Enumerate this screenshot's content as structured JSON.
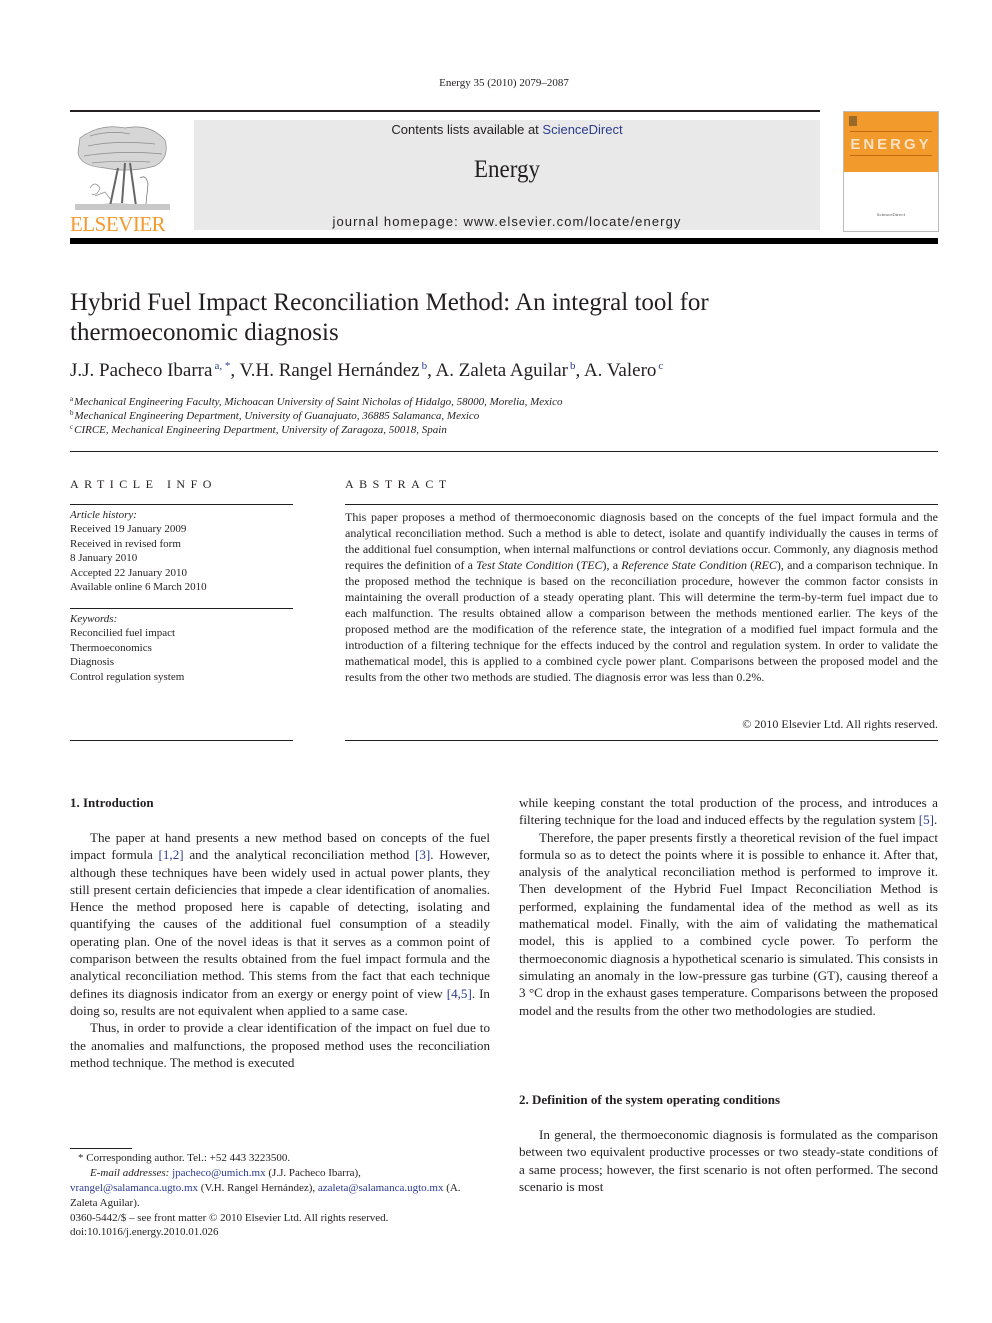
{
  "header": {
    "journal_ref": "Energy 35 (2010) 2079–2087",
    "contents_prefix": "Contents lists available at ",
    "contents_link": "ScienceDirect",
    "journal_name": "Energy",
    "homepage": "journal homepage: www.elsevier.com/locate/energy",
    "publisher_logo_text": "ELSEVIER",
    "cover_title": "ENERGY",
    "colors": {
      "publisher_orange": "#f39a2c",
      "link_blue": "#2b3b8f"
    }
  },
  "article": {
    "title": "Hybrid Fuel Impact Reconciliation Method: An integral tool for thermoeconomic diagnosis",
    "authors": [
      {
        "name": "J.J. Pacheco Ibarra",
        "sup": "a, *"
      },
      {
        "name": "V.H. Rangel Hernández",
        "sup": "b"
      },
      {
        "name": "A. Zaleta Aguilar",
        "sup": "b"
      },
      {
        "name": "A. Valero",
        "sup": "c"
      }
    ],
    "affiliations": [
      {
        "key": "a",
        "text": "Mechanical Engineering Faculty, Michoacan University of Saint Nicholas of Hidalgo, 58000, Morelia, Mexico"
      },
      {
        "key": "b",
        "text": "Mechanical Engineering Department, University of Guanajuato, 36885 Salamanca, Mexico"
      },
      {
        "key": "c",
        "text": "CIRCE, Mechanical Engineering Department, University of Zaragoza, 50018, Spain"
      }
    ]
  },
  "article_info": {
    "heading": "ARTICLE INFO",
    "history_label": "Article history:",
    "history": [
      "Received 19 January 2009",
      "Received in revised form",
      "8 January 2010",
      "Accepted 22 January 2010",
      "Available online 6 March 2010"
    ],
    "keywords_label": "Keywords:",
    "keywords": [
      "Reconcilied fuel impact",
      "Thermoeconomics",
      "Diagnosis",
      "Control regulation system"
    ]
  },
  "abstract": {
    "heading": "ABSTRACT",
    "part1": "This paper proposes a method of thermoeconomic diagnosis based on the concepts of the fuel impact formula and the analytical reconciliation method. Such a method is able to detect, isolate and quantify individually the causes in terms of the additional fuel consumption, when internal malfunctions or control deviations occur. Commonly, any diagnosis method requires the definition of a ",
    "tsc": "Test State Condition",
    "tec": "TEC",
    "mid": "), a ",
    "rsc": "Reference State Condition",
    "rec": "REC",
    "part2": "), and a comparison technique. In the proposed method the technique is based on the reconciliation procedure, however the common factor consists in maintaining the overall production of a steady operating plant. This will determine the term-by-term fuel impact due to each malfunction. The results obtained allow a comparison between the methods mentioned earlier. The keys of the proposed method are the modification of the reference state, the integration of a modified fuel impact formula and the introduction of a filtering technique for the effects induced by the control and regulation system. In order to validate the mathematical model, this is applied to a combined cycle power plant. Comparisons between the proposed model and the results from the other two methods are studied. The diagnosis error was less than 0.2%.",
    "copyright": "© 2010 Elsevier Ltd. All rights reserved."
  },
  "body": {
    "sec1_title": "1.  Introduction",
    "sec1_p1_a": "The paper at hand presents a new method based on concepts of the fuel impact formula ",
    "ref_12": "[1,2]",
    "sec1_p1_b": " and the analytical reconciliation method ",
    "ref_3": "[3]",
    "sec1_p1_c": ". However, although these techniques have been widely used in actual power plants, they still present certain deficiencies that impede a clear identification of anomalies. Hence the method proposed here is capable of detecting, isolating and quantifying the causes of the additional fuel consumption of a steadily operating plan. One of the novel ideas is that it serves as a common point of comparison between the results obtained from the fuel impact formula and the analytical reconciliation method. This stems from the fact that each technique defines its diagnosis indicator from an exergy or energy point of view ",
    "ref_45": "[4,5]",
    "sec1_p1_d": ". In doing so, results are not equivalent when applied to a same case.",
    "sec1_p2": "Thus, in order to provide a clear identification of the impact on fuel due to the anomalies and malfunctions, the proposed method uses the reconciliation method technique. The method is executed",
    "col2_p1_a": "while keeping constant the total production of the process, and introduces a filtering technique for the load and induced effects by the regulation system ",
    "ref_5": "[5]",
    "col2_p1_b": ".",
    "col2_p2": "Therefore, the paper presents firstly a theoretical revision of the fuel impact formula so as to detect the points where it is possible to enhance it. After that, analysis of the analytical reconciliation method is performed to improve it. Then development of the Hybrid Fuel Impact Reconciliation Method is performed, explaining the fundamental idea of the method as well as its mathematical model. Finally, with the aim of validating the mathematical model, this is applied to a combined cycle power. To perform the thermoeconomic diagnosis a hypothetical scenario is simulated. This consists in simulating an anomaly in the low-pressure gas turbine (GT), causing thereof a 3 °C drop in the exhaust gases temperature. Comparisons between the proposed model and the results from the other two methodologies are studied.",
    "sec2_title": "2.  Definition of the system operating conditions",
    "sec2_p1": "In general, the thermoeconomic diagnosis is formulated as the comparison between two equivalent productive processes or two steady-state conditions of a same process; however, the first scenario is not often performed. The second scenario is most"
  },
  "footnotes": {
    "corresponding": "* Corresponding author. Tel.: +52 443 3223500.",
    "email_label": "E-mail addresses:",
    "email1": "jpacheco@umich.mx",
    "email1_owner": " (J.J. Pacheco Ibarra), ",
    "email2": "vrangel@salamanca.ugto.mx",
    "email2_owner": " (V.H. Rangel Hernández), ",
    "email3": "azaleta@salamanca.ugto.mx",
    "email3_owner": " (A. Zaleta Aguilar).",
    "issn": "0360-5442/$ – see front matter © 2010 Elsevier Ltd. All rights reserved.",
    "doi": "doi:10.1016/j.energy.2010.01.026"
  }
}
